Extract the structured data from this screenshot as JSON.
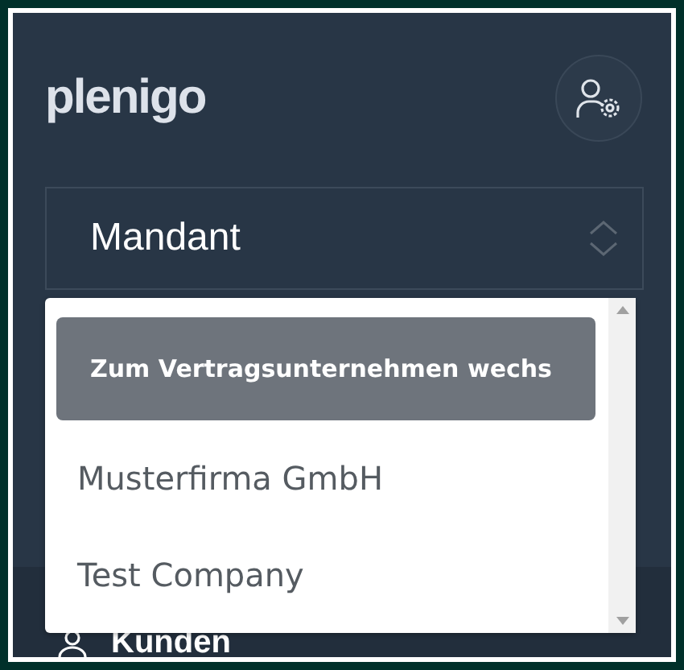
{
  "logo": "plenigo",
  "select": {
    "value": "Mandant"
  },
  "options": [
    {
      "label": "Zum Vertragsunternehmen wechs",
      "selected": true
    },
    {
      "label": "Musterfirma GmbH",
      "selected": false
    },
    {
      "label": "Test Company",
      "selected": false
    }
  ],
  "nav": [
    {
      "label": "Kunden"
    }
  ]
}
